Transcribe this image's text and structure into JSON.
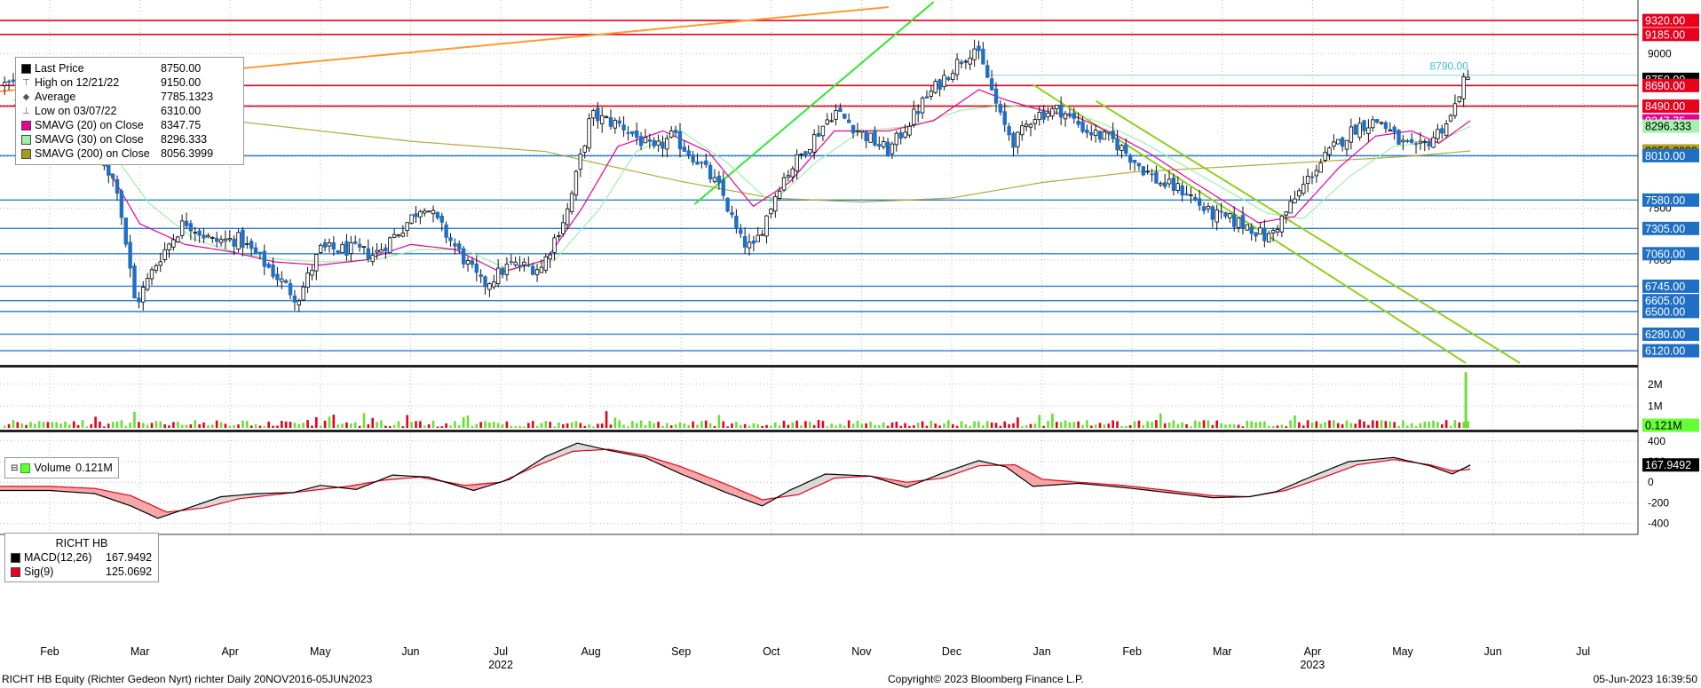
{
  "chart_data": {
    "type": "candlestick",
    "title": "RICHT HB Equity (Richter Gedeon Nyrt) richter  Daily 20NOV2016-05JUN2023",
    "months": [
      "Feb",
      "Mar",
      "Apr",
      "May",
      "Jun",
      "Jul",
      "Aug",
      "Sep",
      "Oct",
      "Nov",
      "Dec",
      "Jan",
      "Feb",
      "Mar",
      "Apr",
      "May",
      "Jun",
      "Jul"
    ],
    "year_labels": [
      {
        "label": "2022",
        "month_index": 5
      },
      {
        "label": "2023",
        "month_index": 14
      }
    ],
    "price_axis_ticks": [
      9000,
      8500,
      8000,
      7500,
      7000
    ],
    "price_range": [
      6000,
      9450
    ],
    "horizontal_levels": {
      "red": [
        9320,
        9185,
        8690,
        8490
      ],
      "blue": [
        8010,
        7580,
        7305,
        7060,
        6745,
        6605,
        6500,
        6280,
        6120
      ]
    },
    "price_tags": [
      {
        "label": "9320.00",
        "value": 9320,
        "bg": "#e8001c",
        "fg": "#ffffff"
      },
      {
        "label": "9185.00",
        "value": 9185,
        "bg": "#e8001c",
        "fg": "#ffffff"
      },
      {
        "label": "8750.00",
        "value": 8750,
        "bg": "#000000",
        "fg": "#ffffff"
      },
      {
        "label": "8690.00",
        "value": 8690,
        "bg": "#e8001c",
        "fg": "#ffffff"
      },
      {
        "label": "8490.00",
        "value": 8490,
        "bg": "#e8001c",
        "fg": "#ffffff"
      },
      {
        "label": "8347.75",
        "value": 8347.75,
        "bg": "#e6009a",
        "fg": "#ffffff"
      },
      {
        "label": "8296.333",
        "value": 8296.333,
        "bg": "#a8f0b0",
        "fg": "#000000"
      },
      {
        "label": "8056.3999",
        "value": 8056.3999,
        "bg": "#b0a020",
        "fg": "#000000"
      },
      {
        "label": "8010.00",
        "value": 8010,
        "bg": "#1f6fc5",
        "fg": "#ffffff"
      },
      {
        "label": "7580.00",
        "value": 7580,
        "bg": "#1f6fc5",
        "fg": "#ffffff"
      },
      {
        "label": "7305.00",
        "value": 7305,
        "bg": "#1f6fc5",
        "fg": "#ffffff"
      },
      {
        "label": "7060.00",
        "value": 7060,
        "bg": "#1f6fc5",
        "fg": "#ffffff"
      },
      {
        "label": "6745.00",
        "value": 6745,
        "bg": "#1f6fc5",
        "fg": "#ffffff"
      },
      {
        "label": "6605.00",
        "value": 6605,
        "bg": "#1f6fc5",
        "fg": "#ffffff"
      },
      {
        "label": "6500.00",
        "value": 6500,
        "bg": "#1f6fc5",
        "fg": "#ffffff"
      },
      {
        "label": "6280.00",
        "value": 6280,
        "bg": "#1f6fc5",
        "fg": "#ffffff"
      },
      {
        "label": "6120.00",
        "value": 6120,
        "bg": "#1f6fc5",
        "fg": "#ffffff"
      }
    ],
    "annotation": {
      "label": "8790.00",
      "value": 8790
    },
    "trendlines": [
      {
        "color": "#ff9a2e",
        "from": {
          "month": -0.6,
          "value": 8630
        },
        "to": {
          "month": 9.3,
          "value": 9450
        }
      },
      {
        "color": "#33e633",
        "from": {
          "month": 7.15,
          "value": 7540
        },
        "to": {
          "month": 9.8,
          "value": 9500
        }
      },
      {
        "color": "#8ed11e",
        "from": {
          "month": 10.9,
          "value": 8700
        },
        "to": {
          "month": 15.7,
          "value": 6000
        }
      },
      {
        "color": "#8ed11e",
        "from": {
          "month": 11.6,
          "value": 8540
        },
        "to": {
          "month": 16.3,
          "value": 6000
        }
      }
    ],
    "close_anchors": [
      [
        0.0,
        8700
      ],
      [
        0.45,
        8200
      ],
      [
        0.75,
        7700
      ],
      [
        0.95,
        6560
      ],
      [
        1.2,
        7000
      ],
      [
        1.5,
        7380
      ],
      [
        1.8,
        7180
      ],
      [
        2.1,
        7200
      ],
      [
        2.4,
        6950
      ],
      [
        2.75,
        6620
      ],
      [
        3.0,
        7100
      ],
      [
        3.35,
        7100
      ],
      [
        3.6,
        7050
      ],
      [
        3.9,
        7300
      ],
      [
        4.15,
        7550
      ],
      [
        4.45,
        7180
      ],
      [
        4.8,
        6750
      ],
      [
        5.1,
        6950
      ],
      [
        5.45,
        6920
      ],
      [
        5.75,
        7500
      ],
      [
        6.0,
        8400
      ],
      [
        6.35,
        8300
      ],
      [
        6.7,
        8050
      ],
      [
        6.9,
        8200
      ],
      [
        7.2,
        7950
      ],
      [
        7.45,
        7660
      ],
      [
        7.65,
        7200
      ],
      [
        7.8,
        7100
      ],
      [
        8.1,
        7750
      ],
      [
        8.4,
        8100
      ],
      [
        8.7,
        8450
      ],
      [
        9.0,
        8230
      ],
      [
        9.3,
        8050
      ],
      [
        9.7,
        8550
      ],
      [
        10.05,
        8900
      ],
      [
        10.25,
        9060
      ],
      [
        10.4,
        8760
      ],
      [
        10.55,
        8350
      ],
      [
        10.7,
        8130
      ],
      [
        10.9,
        8400
      ],
      [
        11.2,
        8460
      ],
      [
        11.5,
        8250
      ],
      [
        11.8,
        8150
      ],
      [
        12.1,
        7900
      ],
      [
        12.3,
        7750
      ],
      [
        12.6,
        7660
      ],
      [
        12.85,
        7450
      ],
      [
        13.1,
        7380
      ],
      [
        13.3,
        7330
      ],
      [
        13.5,
        7200
      ],
      [
        13.7,
        7450
      ],
      [
        14.0,
        7850
      ],
      [
        14.25,
        8100
      ],
      [
        14.5,
        8300
      ],
      [
        14.75,
        8350
      ],
      [
        14.95,
        8150
      ],
      [
        15.15,
        8050
      ],
      [
        15.35,
        8200
      ],
      [
        15.55,
        8400
      ],
      [
        15.65,
        8700
      ],
      [
        15.75,
        8750
      ]
    ],
    "smavg_20_anchors": [
      [
        0.0,
        8500
      ],
      [
        0.5,
        8100
      ],
      [
        1.0,
        7350
      ],
      [
        1.5,
        7150
      ],
      [
        2.0,
        7080
      ],
      [
        2.5,
        6980
      ],
      [
        3.0,
        6950
      ],
      [
        3.5,
        7000
      ],
      [
        4.0,
        7150
      ],
      [
        4.5,
        7100
      ],
      [
        5.0,
        6880
      ],
      [
        5.5,
        7000
      ],
      [
        5.9,
        7500
      ],
      [
        6.3,
        8100
      ],
      [
        6.8,
        8250
      ],
      [
        7.3,
        8050
      ],
      [
        7.8,
        7520
      ],
      [
        8.2,
        7750
      ],
      [
        8.7,
        8250
      ],
      [
        9.3,
        8250
      ],
      [
        9.8,
        8350
      ],
      [
        10.3,
        8650
      ],
      [
        10.6,
        8550
      ],
      [
        11.0,
        8450
      ],
      [
        11.4,
        8380
      ],
      [
        11.8,
        8220
      ],
      [
        12.2,
        8030
      ],
      [
        12.6,
        7800
      ],
      [
        13.0,
        7580
      ],
      [
        13.4,
        7360
      ],
      [
        13.8,
        7420
      ],
      [
        14.3,
        7900
      ],
      [
        14.7,
        8200
      ],
      [
        15.1,
        8250
      ],
      [
        15.4,
        8130
      ],
      [
        15.75,
        8350
      ]
    ],
    "smavg_30_anchors": [
      [
        0.0,
        8650
      ],
      [
        0.6,
        8150
      ],
      [
        1.1,
        7550
      ],
      [
        1.6,
        7200
      ],
      [
        2.1,
        7060
      ],
      [
        2.6,
        7000
      ],
      [
        3.1,
        6980
      ],
      [
        3.6,
        7000
      ],
      [
        4.1,
        7100
      ],
      [
        4.6,
        7100
      ],
      [
        5.1,
        6900
      ],
      [
        5.6,
        7000
      ],
      [
        6.1,
        7500
      ],
      [
        6.5,
        8050
      ],
      [
        7.0,
        8250
      ],
      [
        7.5,
        7950
      ],
      [
        8.0,
        7550
      ],
      [
        8.5,
        7950
      ],
      [
        9.0,
        8250
      ],
      [
        9.6,
        8300
      ],
      [
        10.1,
        8450
      ],
      [
        10.6,
        8500
      ],
      [
        11.1,
        8450
      ],
      [
        11.6,
        8350
      ],
      [
        12.1,
        8150
      ],
      [
        12.6,
        7900
      ],
      [
        13.1,
        7650
      ],
      [
        13.5,
        7450
      ],
      [
        13.9,
        7400
      ],
      [
        14.4,
        7800
      ],
      [
        14.9,
        8100
      ],
      [
        15.4,
        8150
      ],
      [
        15.75,
        8296
      ]
    ],
    "smavg_200_anchors": [
      [
        0.0,
        8550
      ],
      [
        2.0,
        8350
      ],
      [
        4.0,
        8150
      ],
      [
        5.5,
        8050
      ],
      [
        6.0,
        7950
      ],
      [
        7.0,
        7760
      ],
      [
        8.0,
        7600
      ],
      [
        9.0,
        7560
      ],
      [
        10.0,
        7600
      ],
      [
        11.0,
        7750
      ],
      [
        12.0,
        7850
      ],
      [
        13.0,
        7900
      ],
      [
        14.0,
        7950
      ],
      [
        15.0,
        8000
      ],
      [
        15.75,
        8056
      ]
    ],
    "legend_main": [
      {
        "icon": "last",
        "label": "Last Price",
        "value": "8750.00",
        "color": "#000000"
      },
      {
        "icon": "high",
        "label": "High on 12/21/22",
        "value": "9150.00",
        "color": ""
      },
      {
        "icon": "avg",
        "label": "Average",
        "value": "7785.1323",
        "color": ""
      },
      {
        "icon": "low",
        "label": "Low on 03/07/22",
        "value": "6310.00",
        "color": ""
      },
      {
        "icon": "sma20",
        "label": "SMAVG (20)  on Close",
        "value": "8347.75",
        "color": "#e6009a"
      },
      {
        "icon": "sma30",
        "label": "SMAVG (30)  on Close",
        "value": "8296.333",
        "color": "#9ff0a8"
      },
      {
        "icon": "sma200",
        "label": "SMAVG (200)  on Close",
        "value": "8056.3999",
        "color": "#a89a18"
      }
    ],
    "volume": {
      "legend_label": "Volume",
      "legend_value": "0.121M",
      "axis_ticks": [
        "2M",
        "1M"
      ],
      "axis_tick_values": [
        2000000,
        1000000
      ],
      "last_tag": "0.121M",
      "last_value": 121000,
      "range": [
        0,
        2600000
      ],
      "spike": {
        "month": 15.7,
        "value": 2550000
      }
    },
    "macd": {
      "legend_title": "RICHT HB",
      "series": [
        {
          "name": "MACD(12,26)",
          "value": "167.9492",
          "color": "#000000"
        },
        {
          "name": "Sig(9)",
          "value": "125.0692",
          "color": "#e8001c"
        }
      ],
      "axis_ticks": [
        400,
        200,
        0,
        -200,
        -400
      ],
      "range": [
        -420,
        450
      ],
      "last_tag": "167.9492",
      "macd_anchors": [
        [
          0.0,
          -80
        ],
        [
          0.5,
          -110
        ],
        [
          0.9,
          -230
        ],
        [
          1.2,
          -350
        ],
        [
          1.5,
          -260
        ],
        [
          1.9,
          -140
        ],
        [
          2.3,
          -110
        ],
        [
          2.7,
          -100
        ],
        [
          3.0,
          -30
        ],
        [
          3.4,
          -70
        ],
        [
          3.8,
          70
        ],
        [
          4.2,
          50
        ],
        [
          4.7,
          -80
        ],
        [
          5.1,
          30
        ],
        [
          5.5,
          250
        ],
        [
          5.85,
          380
        ],
        [
          6.2,
          310
        ],
        [
          6.6,
          240
        ],
        [
          7.0,
          80
        ],
        [
          7.5,
          -100
        ],
        [
          7.9,
          -230
        ],
        [
          8.2,
          -80
        ],
        [
          8.6,
          80
        ],
        [
          9.1,
          60
        ],
        [
          9.5,
          -50
        ],
        [
          9.9,
          90
        ],
        [
          10.3,
          210
        ],
        [
          10.6,
          150
        ],
        [
          10.9,
          -40
        ],
        [
          11.4,
          -10
        ],
        [
          11.9,
          -50
        ],
        [
          12.4,
          -100
        ],
        [
          12.9,
          -150
        ],
        [
          13.3,
          -140
        ],
        [
          13.6,
          -90
        ],
        [
          14.0,
          60
        ],
        [
          14.4,
          200
        ],
        [
          14.9,
          240
        ],
        [
          15.3,
          160
        ],
        [
          15.55,
          80
        ],
        [
          15.75,
          168
        ]
      ],
      "signal_anchors": [
        [
          0.0,
          -40
        ],
        [
          0.5,
          -60
        ],
        [
          0.9,
          -130
        ],
        [
          1.3,
          -290
        ],
        [
          1.7,
          -250
        ],
        [
          2.1,
          -160
        ],
        [
          2.5,
          -120
        ],
        [
          2.9,
          -80
        ],
        [
          3.3,
          -40
        ],
        [
          3.7,
          20
        ],
        [
          4.1,
          50
        ],
        [
          4.6,
          -30
        ],
        [
          5.0,
          0
        ],
        [
          5.4,
          160
        ],
        [
          5.8,
          300
        ],
        [
          6.2,
          320
        ],
        [
          6.6,
          260
        ],
        [
          7.0,
          150
        ],
        [
          7.5,
          -20
        ],
        [
          7.9,
          -170
        ],
        [
          8.3,
          -120
        ],
        [
          8.7,
          40
        ],
        [
          9.1,
          60
        ],
        [
          9.5,
          0
        ],
        [
          9.9,
          40
        ],
        [
          10.3,
          160
        ],
        [
          10.7,
          170
        ],
        [
          11.0,
          30
        ],
        [
          11.4,
          0
        ],
        [
          11.9,
          -30
        ],
        [
          12.4,
          -80
        ],
        [
          12.9,
          -130
        ],
        [
          13.3,
          -140
        ],
        [
          13.7,
          -80
        ],
        [
          14.1,
          40
        ],
        [
          14.5,
          170
        ],
        [
          14.9,
          220
        ],
        [
          15.3,
          170
        ],
        [
          15.55,
          110
        ],
        [
          15.75,
          125
        ]
      ]
    }
  },
  "footer": {
    "left": "RICHT HB Equity (Richter Gedeon Nyrt) richter  Daily 20NOV2016-05JUN2023",
    "center": "Copyright© 2023 Bloomberg Finance L.P.",
    "right": "05-Jun-2023 16:39:50"
  }
}
